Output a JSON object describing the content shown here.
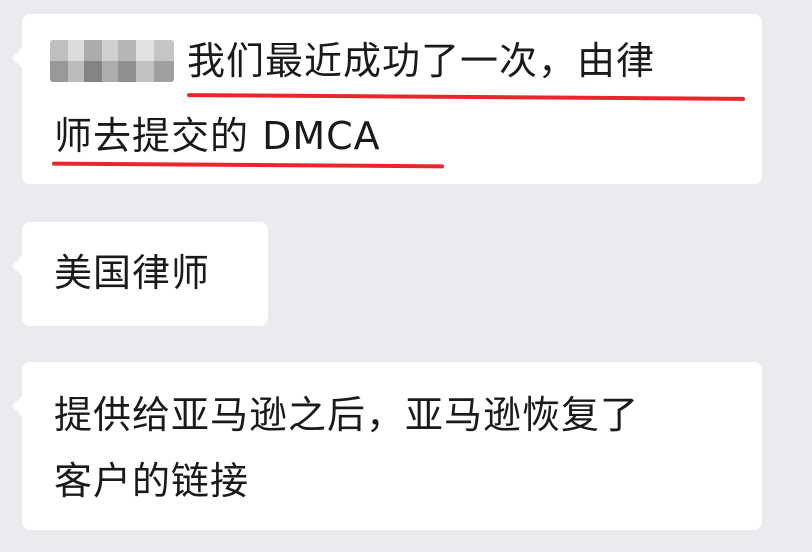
{
  "messages": [
    {
      "lines": [
        "我们最近成功了一次，由律",
        "师去提交的 DMCA"
      ],
      "redacted_sender": true
    },
    {
      "lines": [
        "美国律师"
      ]
    },
    {
      "lines": [
        "提供给亚马逊之后，亚马逊恢复了",
        "客户的链接"
      ]
    }
  ],
  "colors": {
    "background": "#eceaef",
    "bubble": "#ffffff",
    "text": "#1a1a1a",
    "underline": "#e8262b"
  }
}
